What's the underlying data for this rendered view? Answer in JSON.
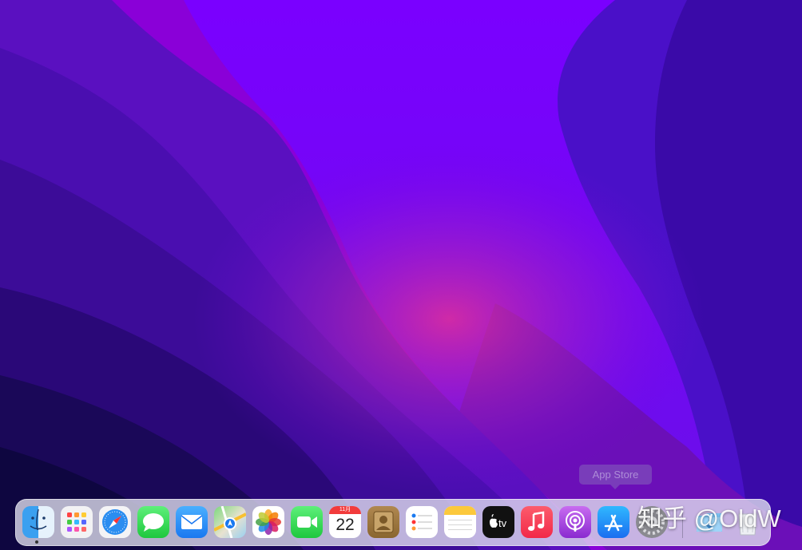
{
  "desktop": {
    "wallpaper": "macOS Monterey purple wallpaper"
  },
  "tooltip": {
    "label": "App Store"
  },
  "dock": {
    "apps": [
      {
        "name": "Finder",
        "icon": "finder-icon",
        "running": true
      },
      {
        "name": "Launchpad",
        "icon": "launchpad-icon",
        "running": false
      },
      {
        "name": "Safari",
        "icon": "safari-icon",
        "running": false
      },
      {
        "name": "Messages",
        "icon": "messages-icon",
        "running": false
      },
      {
        "name": "Mail",
        "icon": "mail-icon",
        "running": false
      },
      {
        "name": "Maps",
        "icon": "maps-icon",
        "running": false
      },
      {
        "name": "Photos",
        "icon": "photos-icon",
        "running": false
      },
      {
        "name": "FaceTime",
        "icon": "facetime-icon",
        "running": false
      },
      {
        "name": "Calendar",
        "icon": "calendar-icon",
        "running": false,
        "month": "11月",
        "day": "22"
      },
      {
        "name": "Contacts",
        "icon": "contacts-icon",
        "running": false
      },
      {
        "name": "Reminders",
        "icon": "reminders-icon",
        "running": false
      },
      {
        "name": "Notes",
        "icon": "notes-icon",
        "running": false
      },
      {
        "name": "TV",
        "icon": "tv-icon",
        "running": false,
        "label": "tv"
      },
      {
        "name": "Music",
        "icon": "music-icon",
        "running": false
      },
      {
        "name": "Podcasts",
        "icon": "podcasts-icon",
        "running": false
      },
      {
        "name": "App Store",
        "icon": "app-store-icon",
        "running": false
      },
      {
        "name": "System Preferences",
        "icon": "system-preferences-icon",
        "running": false
      },
      {
        "name": "Downloads",
        "icon": "downloads-folder-icon",
        "running": false
      },
      {
        "name": "Trash",
        "icon": "trash-icon",
        "running": false
      }
    ]
  },
  "watermark": {
    "text": "知乎 @OldW"
  }
}
